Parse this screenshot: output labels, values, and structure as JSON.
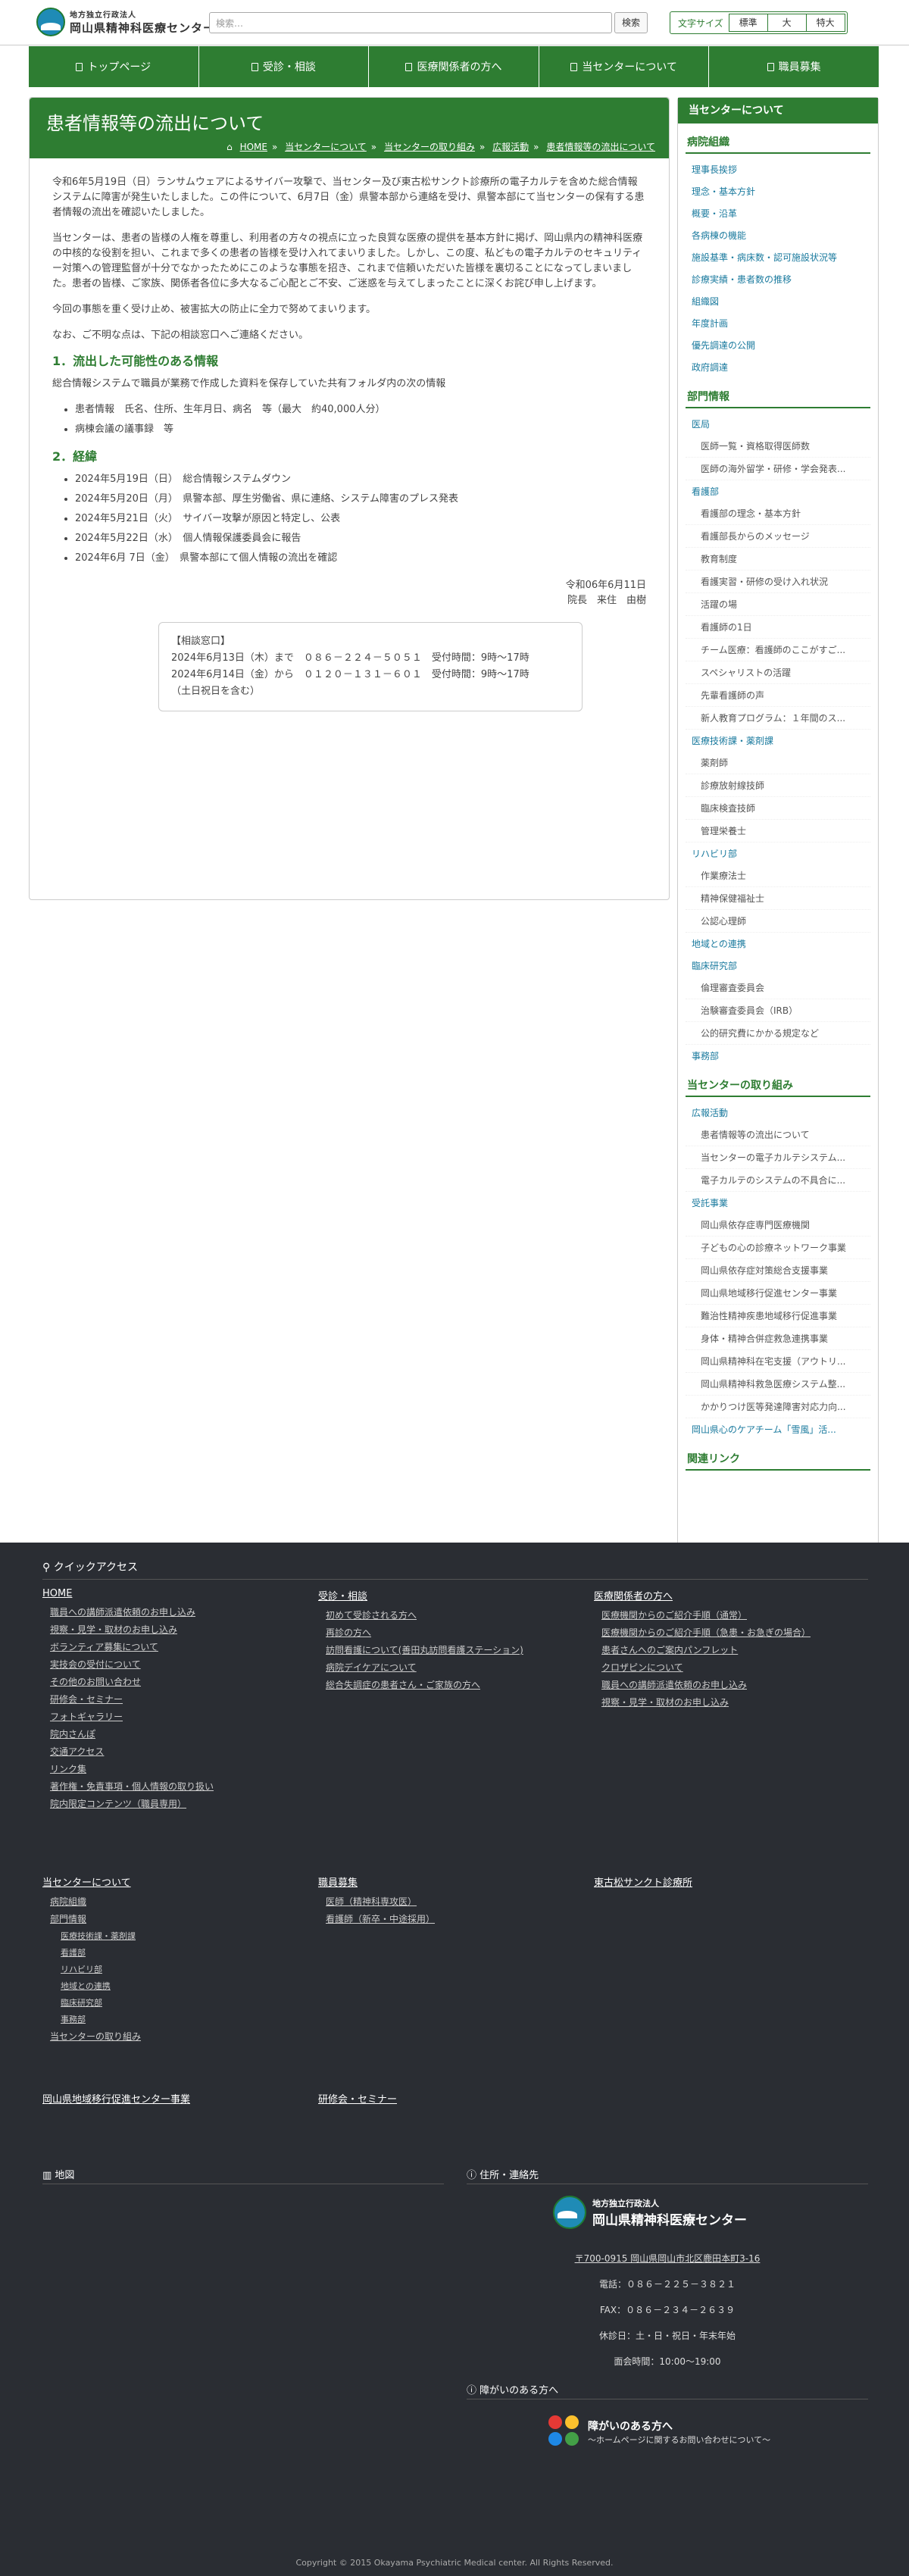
{
  "header": {
    "logo_small": "地方独立行政法人",
    "logo_big": "岡山県精神科医療センター",
    "search_placeholder": "検索…",
    "search_button": "検索",
    "font_label": "文字サイズ",
    "font_options": [
      "標準",
      "大",
      "特大"
    ]
  },
  "nav": [
    "トップページ",
    "受診・相談",
    "医療関係者の方へ",
    "当センターについて",
    "職員募集"
  ],
  "main": {
    "title": "患者情報等の流出について",
    "breadcrumb": [
      "HOME",
      "当センターについて",
      "当センターの取り組み",
      "広報活動",
      "患者情報等の流出について"
    ],
    "p1": "令和6年5月19日（日）ランサムウェアによるサイバー攻撃で、当センター及び東古松サンクト診療所の電子カルテを含めた総合情報システムに障害が発生いたしました。この件について、6月7日（金）県警本部から連絡を受け、県警本部にて当センターの保有する患者情報の流出を確認いたしました。",
    "p2": "当センターは、患者の皆様の人権を尊重し、利用者の方々の視点に立った良質な医療の提供を基本方針に掲げ、岡山県内の精神科医療の中核的な役割を担い、これまで多くの患者の皆様を受け入れてまいりました。しかし、この度、私どもの電子カルテのセキュリティー対策への管理監督が十分でなかったためにこのような事態を招き、これまで信頼いただいた皆様を裏切ることになってしまいました。患者の皆様、ご家族、関係者各位に多大なるご心配とご不安、ご迷惑を与えてしまったことに深くお詫び申し上げます。",
    "p3": "今回の事態を重く受け止め、被害拡大の防止に全力で努めてまいります。",
    "p4": "なお、ご不明な点は、下記の相談窓口へご連絡ください。",
    "h1": "1．流出した可能性のある情報",
    "h1_text": "総合情報システムで職員が業務で作成した資料を保存していた共有フォルダ内の次の情報",
    "list1": [
      "患者情報　氏名、住所、生年月日、病名　等（最大　約40,000人分）",
      "病棟会議の議事録　等"
    ],
    "h2": "2．経緯",
    "timeline": [
      {
        "date": "2024年5月19日（日）",
        "event": "総合情報システムダウン"
      },
      {
        "date": "2024年5月20日（月）",
        "event": "県警本部、厚生労働省、県に連絡、システム障害のプレス発表"
      },
      {
        "date": "2024年5月21日（火）",
        "event": "サイバー攻撃が原因と特定し、公表"
      },
      {
        "date": "2024年5月22日（水）",
        "event": "個人情報保護委員会に報告"
      },
      {
        "date": "2024年6月 7日（金）",
        "event": "県警本部にて個人情報の流出を確認"
      }
    ],
    "sig_date": "令和06年6月11日",
    "sig_name": "院長　来住　由樹",
    "contact": {
      "title": "【相談窓口】",
      "line1": "2024年6月13日（木）まで　０８６－２２４－５０５１　受付時間：9時～17時",
      "line2": "2024年6月14日（金）から　０１２０－１３１－６０１　受付時間：9時～17時",
      "note": "（土日祝日を含む）"
    }
  },
  "sidebar": {
    "header": "当センターについて",
    "org_title": "病院組織",
    "org_links": [
      "理事長挨拶",
      "理念・基本方針",
      "概要・沿革",
      "各病棟の機能",
      "施設基準・病床数・認可施設状況等",
      "診療実績・患者数の推移",
      "組織図",
      "年度計画",
      "優先調達の公開",
      "政府調達"
    ],
    "dept_title": "部門情報",
    "groups": [
      {
        "name": "医局",
        "subs": [
          "医師一覧・資格取得医師数",
          "医師の海外留学・研修・学会発表..."
        ]
      },
      {
        "name": "看護部",
        "subs": [
          "看護部の理念・基本方針",
          "看護部長からのメッセージ",
          "教育制度",
          "看護実習・研修の受け入れ状況",
          "活躍の場",
          "看護師の1日",
          "チーム医療：看護師のここがすご...",
          "スペシャリストの活躍",
          "先輩看護師の声",
          "新人教育プログラム：１年間のス..."
        ]
      },
      {
        "name": "医療技術課・薬剤課",
        "subs": [
          "薬剤師",
          "診療放射線技師",
          "臨床検査技師",
          "管理栄養士"
        ]
      },
      {
        "name": "リハビリ部",
        "subs": [
          "作業療法士",
          "精神保健福祉士",
          "公認心理師"
        ]
      },
      {
        "name": "地域との連携",
        "subs": []
      },
      {
        "name": "臨床研究部",
        "subs": [
          "倫理審査委員会",
          "治験審査委員会（IRB）",
          "公的研究費にかかる規定など"
        ]
      },
      {
        "name": "事務部",
        "subs": []
      }
    ],
    "efforts_title": "当センターの取り組み",
    "effort_groups": [
      {
        "name": "広報活動",
        "subs": [
          "患者情報等の流出について",
          "当センターの電子カルテシステム...",
          "電子カルテのシステムの不具合に..."
        ]
      },
      {
        "name": "受託事業",
        "subs": [
          "岡山県依存症専門医療機関",
          "子どもの心の診療ネットワーク事業",
          "岡山県依存症対策総合支援事業",
          "岡山県地域移行促進センター事業",
          "難治性精神疾患地域移行促進事業",
          "身体・精神合併症救急連携事業",
          "岡山県精神科在宅支援（アウトリ...",
          "岡山県精神科救急医療システム整...",
          "かかりつけ医等発達障害対応力向..."
        ]
      },
      {
        "name": "岡山県心のケアチーム「雪風」活...",
        "subs": []
      }
    ],
    "related_title": "関連リンク"
  },
  "footer": {
    "qa_title": "クイックアクセス",
    "col1": {
      "head": "HOME",
      "items": [
        "職員への講師派遣依頼のお申し込み",
        "視察・見学・取材のお申し込み",
        "ボランティア募集について",
        "実技会の受付について",
        "その他のお問い合わせ",
        "研修会・セミナー",
        "フォトギャラリー",
        "院内さんぽ",
        "交通アクセス",
        "リンク集",
        "著作権・免責事項・個人情報の取り扱い",
        "院内限定コンテンツ（職員専用）"
      ]
    },
    "col2": {
      "head": "受診・相談",
      "items": [
        "初めて受診される方へ",
        "再診の方へ",
        "訪問看護について(善田丸訪問看護ステーション)",
        "病院デイケアについて",
        "総合失調症の患者さん・ご家族の方へ"
      ]
    },
    "col3": {
      "head": "医療関係者の方へ",
      "items": [
        "医療機関からのご紹介手順（通常）",
        "医療機関からのご紹介手順（急患・お急ぎの場合）",
        "患者さんへのご案内パンフレット",
        "クロザピンについて",
        "職員への講師派遣依頼のお申し込み",
        "視察・見学・取材のお申し込み"
      ]
    },
    "col4": {
      "head": "当センターについて",
      "items": [
        "病院組織",
        "部門情報"
      ],
      "subitems": [
        "医療技術課・薬剤課",
        "看護部",
        "リハビリ部",
        "地域との連携",
        "臨床研究部",
        "事務部"
      ],
      "last": "当センターの取り組み"
    },
    "col5": {
      "head": "職員募集",
      "items": [
        "医師（精神科専攻医）",
        "看護師（新卒・中途採用）"
      ]
    },
    "col6": {
      "head": "東古松サンクト診療所",
      "items": []
    },
    "col7": {
      "head": "岡山県地域移行促進センター事業"
    },
    "col8": {
      "head": "研修会・セミナー"
    },
    "map_title": "地図",
    "addr_title": "住所・連絡先",
    "org_small": "地方独立行政法人",
    "org_big": "岡山県精神科医療センター",
    "address": "〒700-0915 岡山県岡山市北区鹿田本町3-16",
    "tel": "電話：０８６－２２５－３８２１",
    "fax": "FAX：０８６－２３４－２６３９",
    "holiday": "休診日：土・日・祝日・年末年始",
    "visit": "面会時間：10:00～19:00",
    "disab_title": "障がいのある方へ",
    "disab_big": "障がいのある方へ",
    "disab_small": "〜ホームページに関するお問い合わせについて〜",
    "copyright": "Copyright © 2015 Okayama Psychiatric Medical center. All Rights Reserved."
  }
}
